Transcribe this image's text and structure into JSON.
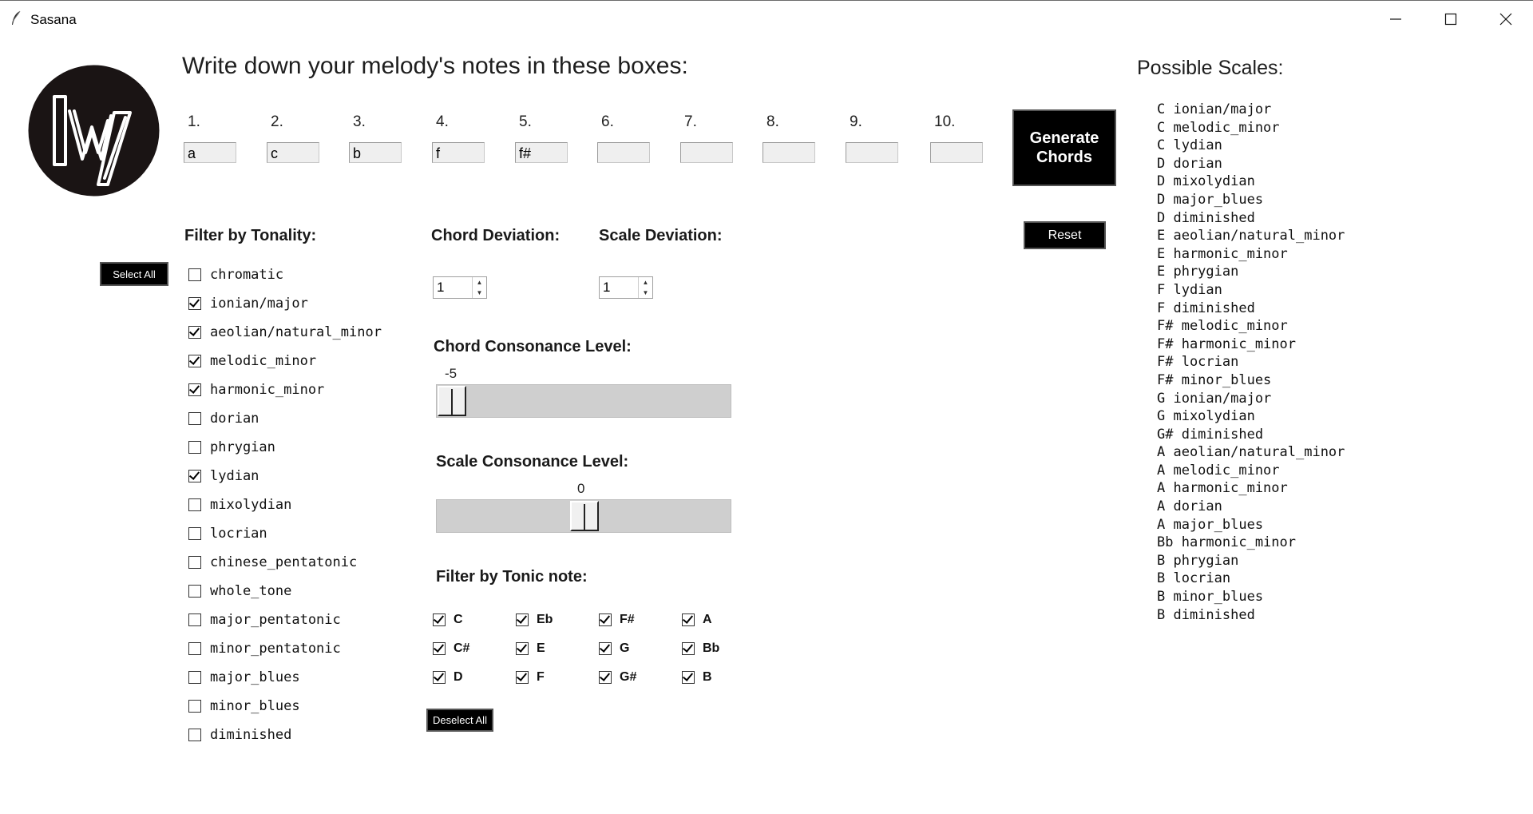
{
  "window": {
    "title": "Sasana"
  },
  "heading": "Write down your melody's notes in these boxes:",
  "notes": [
    {
      "label": "1.",
      "value": "a"
    },
    {
      "label": "2.",
      "value": "c"
    },
    {
      "label": "3.",
      "value": "b"
    },
    {
      "label": "4.",
      "value": "f"
    },
    {
      "label": "5.",
      "value": "f#"
    },
    {
      "label": "6.",
      "value": ""
    },
    {
      "label": "7.",
      "value": ""
    },
    {
      "label": "8.",
      "value": ""
    },
    {
      "label": "9.",
      "value": ""
    },
    {
      "label": "10.",
      "value": ""
    }
  ],
  "buttons": {
    "generate_line1": "Generate",
    "generate_line2": "Chords",
    "reset": "Reset",
    "select_all": "Select All",
    "deselect_all": "Deselect All"
  },
  "tonality": {
    "title": "Filter by Tonality:",
    "items": [
      {
        "label": "chromatic",
        "checked": false
      },
      {
        "label": "ionian/major",
        "checked": true
      },
      {
        "label": "aeolian/natural_minor",
        "checked": true
      },
      {
        "label": "melodic_minor",
        "checked": true
      },
      {
        "label": "harmonic_minor",
        "checked": true
      },
      {
        "label": "dorian",
        "checked": false
      },
      {
        "label": "phrygian",
        "checked": false
      },
      {
        "label": "lydian",
        "checked": true
      },
      {
        "label": "mixolydian",
        "checked": false
      },
      {
        "label": "locrian",
        "checked": false
      },
      {
        "label": "chinese_pentatonic",
        "checked": false
      },
      {
        "label": "whole_tone",
        "checked": false
      },
      {
        "label": "major_pentatonic",
        "checked": false
      },
      {
        "label": "minor_pentatonic",
        "checked": false
      },
      {
        "label": "major_blues",
        "checked": false
      },
      {
        "label": "minor_blues",
        "checked": false
      },
      {
        "label": "diminished",
        "checked": false
      }
    ]
  },
  "chord_deviation": {
    "title": "Chord Deviation:",
    "value": "1"
  },
  "scale_deviation": {
    "title": "Scale Deviation:",
    "value": "1"
  },
  "chord_consonance": {
    "title": "Chord Consonance Level:",
    "value": "-5",
    "min": -5,
    "max": 5
  },
  "scale_consonance": {
    "title": "Scale Consonance Level:",
    "value": "0",
    "min": -5,
    "max": 5
  },
  "tonic": {
    "title": "Filter by Tonic note:",
    "items": [
      {
        "label": "C",
        "checked": true
      },
      {
        "label": "C#",
        "checked": true
      },
      {
        "label": "D",
        "checked": true
      },
      {
        "label": "Eb",
        "checked": true
      },
      {
        "label": "E",
        "checked": true
      },
      {
        "label": "F",
        "checked": true
      },
      {
        "label": "F#",
        "checked": true
      },
      {
        "label": "G",
        "checked": true
      },
      {
        "label": "G#",
        "checked": true
      },
      {
        "label": "A",
        "checked": true
      },
      {
        "label": "Bb",
        "checked": true
      },
      {
        "label": "B",
        "checked": true
      }
    ]
  },
  "possible_scales": {
    "title": "Possible Scales:",
    "items": [
      "C ionian/major",
      "C melodic_minor",
      "C lydian",
      "D dorian",
      "D mixolydian",
      "D major_blues",
      "D diminished",
      "E aeolian/natural_minor",
      "E harmonic_minor",
      "E phrygian",
      "F lydian",
      "F diminished",
      "F# melodic_minor",
      "F# harmonic_minor",
      "F# locrian",
      "F# minor_blues",
      "G ionian/major",
      "G mixolydian",
      "G# diminished",
      "A aeolian/natural_minor",
      "A melodic_minor",
      "A harmonic_minor",
      "A dorian",
      "A major_blues",
      "Bb harmonic_minor",
      "B phrygian",
      "B locrian",
      "B minor_blues",
      "B diminished"
    ]
  }
}
